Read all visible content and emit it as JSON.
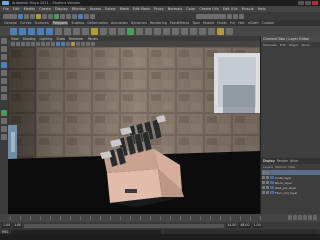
{
  "window": {
    "title": "Autodesk Maya 2011 - Student Version",
    "buttons": [
      "minimize",
      "maximize",
      "close"
    ]
  },
  "menubar": {
    "items": [
      "File",
      "Edit",
      "Modify",
      "Create",
      "Display",
      "Window",
      "Assets",
      "Select",
      "Mesh",
      "Edit Mesh",
      "Proxy",
      "Normals",
      "Color",
      "Create UVs",
      "Edit UVs",
      "Muscle",
      "Help"
    ]
  },
  "shelf": {
    "tabs": [
      "General",
      "Curves",
      "Surfaces",
      "Polygons",
      "Subdivs",
      "Deformation",
      "Animation",
      "Dynamics",
      "Rendering",
      "PaintEffects",
      "Toon",
      "Muscle",
      "Fluids",
      "Fur",
      "Hair",
      "nCloth",
      "Custom"
    ],
    "active_tab": "Polygons"
  },
  "viewport": {
    "panel_menu": [
      "View",
      "Shading",
      "Lighting",
      "Show",
      "Renderer",
      "Panels"
    ]
  },
  "channel_box": {
    "title": "Channel Box / Layer Editor",
    "menu": [
      "Channels",
      "Edit",
      "Object",
      "Show"
    ]
  },
  "layer_editor": {
    "tabs": [
      "Display",
      "Render",
      "Anim"
    ],
    "active_tab": "Display",
    "menu": [
      "Layers",
      "Options",
      "Help"
    ],
    "layers": [
      {
        "name": "",
        "selected": true
      },
      {
        "name": "Knife_layer"
      },
      {
        "name": "Block_layer"
      },
      {
        "name": "Wall_pol_layer"
      },
      {
        "name": "Floor_pol_layer"
      }
    ]
  },
  "time": {
    "start": "1.00",
    "end": "24.00",
    "range_start": "1.00",
    "range_end": "48.00",
    "current": "1.00"
  },
  "command_line": {
    "label": "MEL"
  },
  "colors": {
    "wall": "#7d6e5e",
    "floor": "#0d0d0d",
    "block": "#e0b8a8",
    "highlight": "#5a6e8a"
  }
}
